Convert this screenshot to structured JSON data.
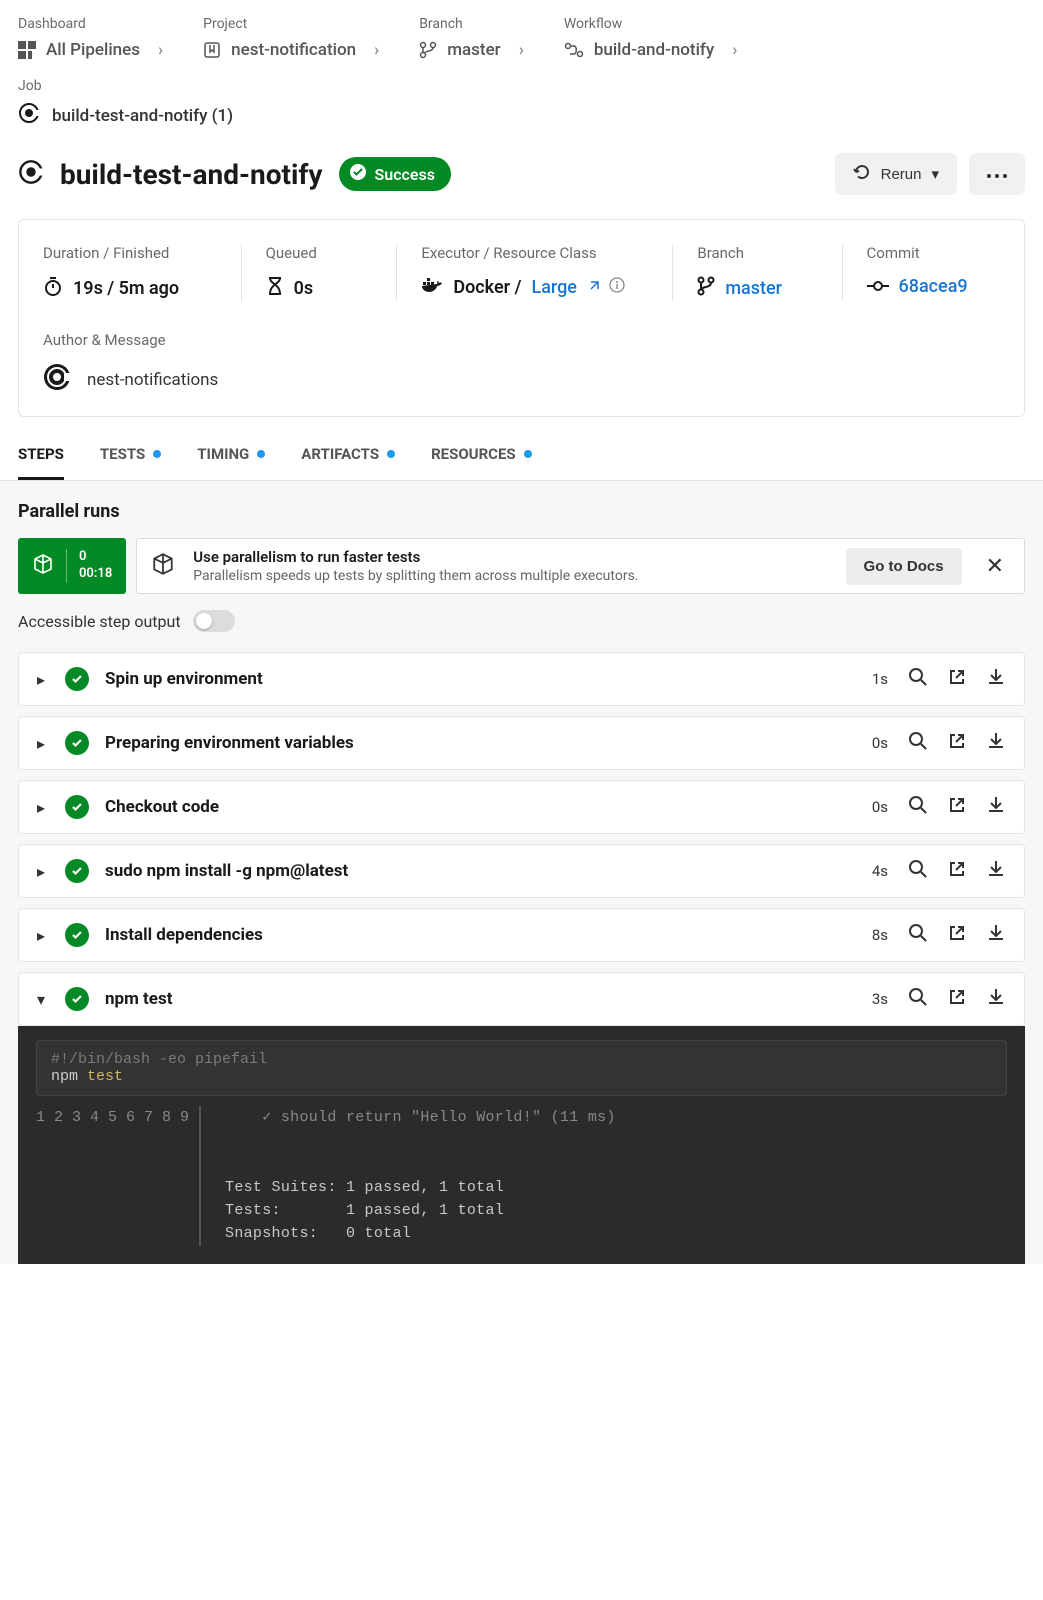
{
  "breadcrumbs": {
    "dashboard": {
      "label": "Dashboard",
      "link": "All Pipelines"
    },
    "project": {
      "label": "Project",
      "link": "nest-notification"
    },
    "branch": {
      "label": "Branch",
      "link": "master"
    },
    "workflow": {
      "label": "Workflow",
      "link": "build-and-notify"
    }
  },
  "job": {
    "label": "Job",
    "name": "build-test-and-notify (1)"
  },
  "title": "build-test-and-notify",
  "status": "Success",
  "rerun_label": "Rerun",
  "summary": {
    "duration_label": "Duration / Finished",
    "duration_value": "19s / 5m ago",
    "queued_label": "Queued",
    "queued_value": "0s",
    "executor_label": "Executor / Resource Class",
    "executor_value_prefix": "Docker /",
    "executor_link": "Large",
    "branch_label": "Branch",
    "branch_value": "master",
    "commit_label": "Commit",
    "commit_value": "68acea9",
    "author_label": "Author & Message",
    "author_value": "nest-notifications"
  },
  "tabs": {
    "steps": "STEPS",
    "tests": "TESTS",
    "timing": "TIMING",
    "artifacts": "ARTIFACTS",
    "resources": "RESOURCES"
  },
  "parallel": {
    "section_title": "Parallel runs",
    "index": "0",
    "time": "00:18",
    "tip_title": "Use parallelism to run faster tests",
    "tip_sub": "Parallelism speeds up tests by splitting them across multiple executors.",
    "go_docs": "Go to Docs"
  },
  "accessible_label": "Accessible step output",
  "steps": [
    {
      "name": "Spin up environment",
      "time": "1s",
      "expanded": false
    },
    {
      "name": "Preparing environment variables",
      "time": "0s",
      "expanded": false
    },
    {
      "name": "Checkout code",
      "time": "0s",
      "expanded": false
    },
    {
      "name": "sudo npm install -g npm@latest",
      "time": "4s",
      "expanded": false
    },
    {
      "name": "Install dependencies",
      "time": "8s",
      "expanded": false
    },
    {
      "name": "npm test",
      "time": "3s",
      "expanded": true
    }
  ],
  "terminal": {
    "cmd_comment": "#!/bin/bash -eo pipefail",
    "cmd_line_prefix": "npm ",
    "cmd_line_kw": "test",
    "line_numbers": [
      "1",
      "2",
      "3",
      "4",
      "5",
      "6",
      "7",
      "8",
      "9"
    ],
    "output_faint": "    ✓ should return \"Hello World!\" (11 ms)",
    "output_body": "\n\n\nTest Suites: 1 passed, 1 total\nTests:       1 passed, 1 total\nSnapshots:   0 total"
  }
}
